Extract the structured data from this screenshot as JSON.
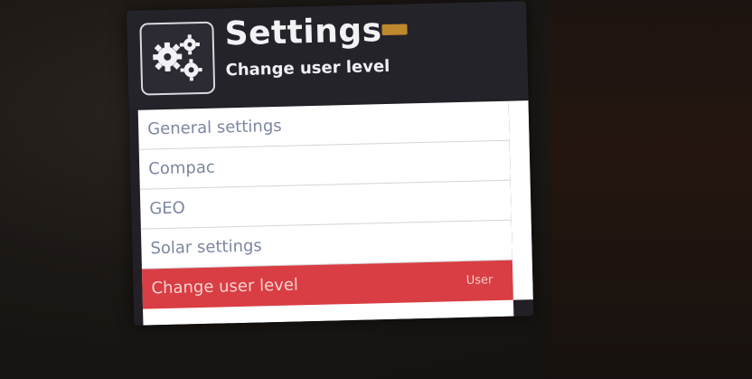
{
  "header": {
    "title": "Settings",
    "subtitle": "Change user level",
    "icon": "gears-icon"
  },
  "menu": {
    "items": [
      {
        "label": "General settings"
      },
      {
        "label": "Compac"
      },
      {
        "label": "GEO"
      },
      {
        "label": "Solar settings"
      },
      {
        "label": "Change user level",
        "value": "User",
        "selected": true
      }
    ]
  },
  "colors": {
    "header_bg": "#25232a",
    "list_bg": "#ffffff",
    "item_text": "#7c86a0",
    "selected_bg": "#d83e43",
    "badge": "#d99a2e"
  }
}
